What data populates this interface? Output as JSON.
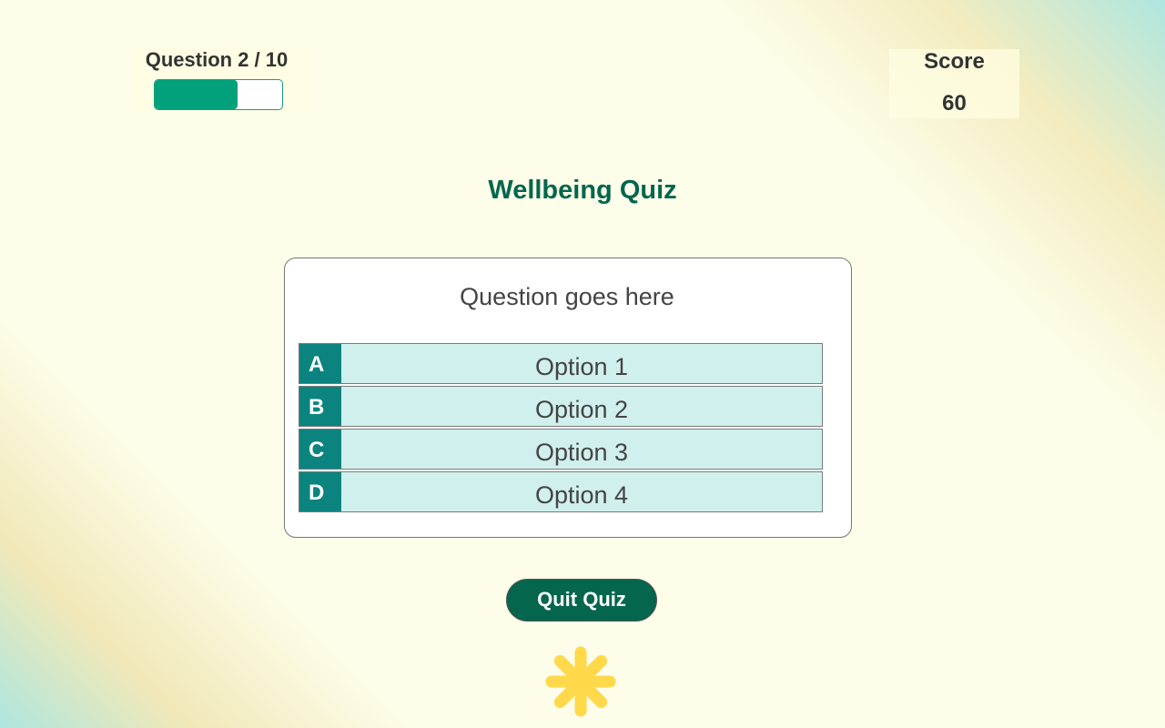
{
  "progress": {
    "question_counter": "Question 2 / 10",
    "fraction": 0.65
  },
  "score": {
    "label": "Score",
    "value": "60"
  },
  "title": "Wellbeing Quiz",
  "question": {
    "text": "Question goes here",
    "options": [
      {
        "letter": "A",
        "label": "Option 1"
      },
      {
        "letter": "B",
        "label": "Option 2"
      },
      {
        "letter": "C",
        "label": "Option 3"
      },
      {
        "letter": "D",
        "label": "Option 4"
      }
    ]
  },
  "actions": {
    "quit_label": "Quit Quiz"
  },
  "decoration": {
    "icon": "sun-icon",
    "icon_color": "#ffd94a"
  },
  "colors": {
    "accent": "#03664d",
    "progress_fill": "#03a07c",
    "option_letter_bg": "#0b8480",
    "option_bg": "#d0f0ee"
  }
}
